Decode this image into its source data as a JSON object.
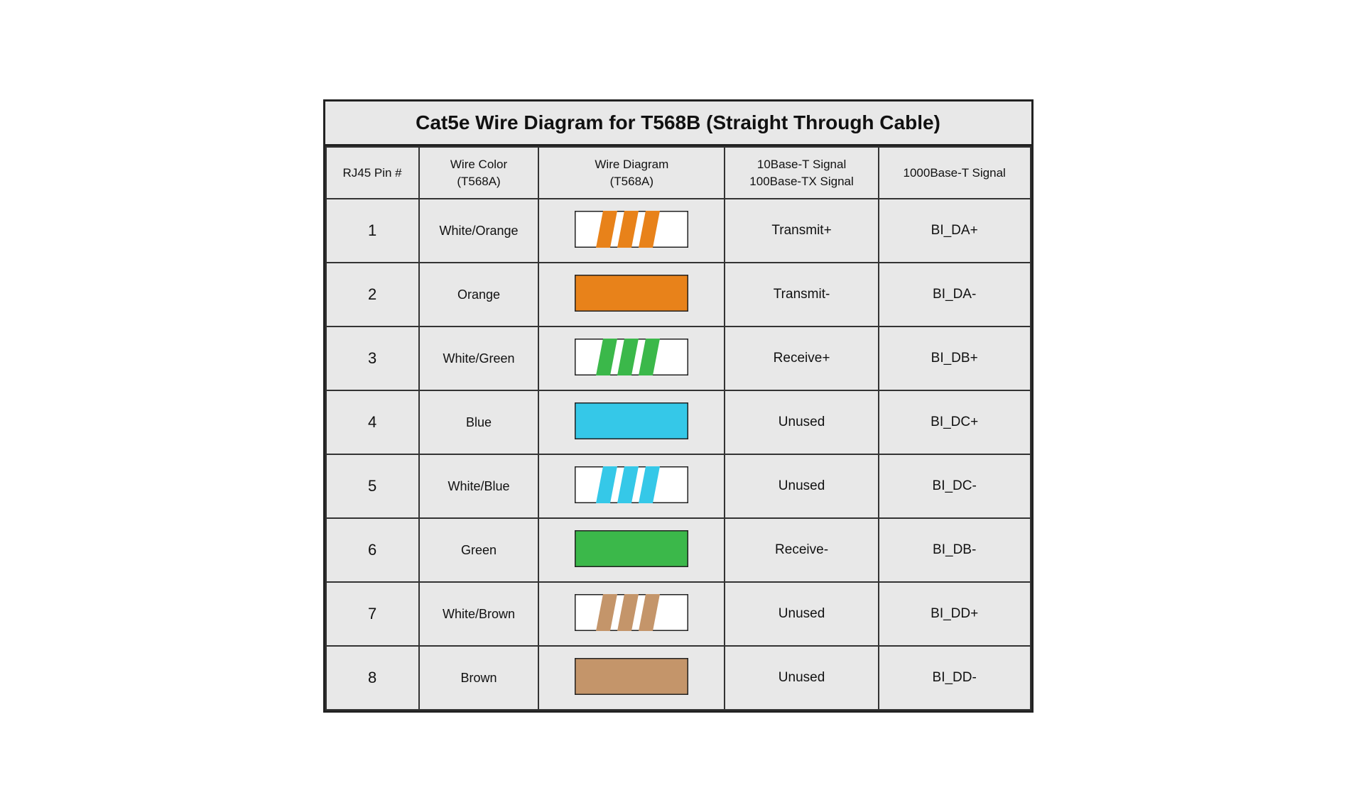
{
  "title": "Cat5e Wire Diagram for T568B (Straight Through Cable)",
  "headers": {
    "col1": "RJ45 Pin #",
    "col2": "Wire Color\n(T568A)",
    "col3": "Wire Diagram\n(T568A)",
    "col4": "10Base-T Signal\n100Base-TX Signal",
    "col5": "1000Base-T Signal"
  },
  "rows": [
    {
      "pin": "1",
      "color": "White/Orange",
      "diagram": "striped-orange",
      "signal_100": "Transmit+",
      "signal_1000": "BI_DA+"
    },
    {
      "pin": "2",
      "color": "Orange",
      "diagram": "solid-orange",
      "signal_100": "Transmit-",
      "signal_1000": "BI_DA-"
    },
    {
      "pin": "3",
      "color": "White/Green",
      "diagram": "striped-green",
      "signal_100": "Receive+",
      "signal_1000": "BI_DB+"
    },
    {
      "pin": "4",
      "color": "Blue",
      "diagram": "solid-blue",
      "signal_100": "Unused",
      "signal_1000": "BI_DC+"
    },
    {
      "pin": "5",
      "color": "White/Blue",
      "diagram": "striped-blue",
      "signal_100": "Unused",
      "signal_1000": "BI_DC-"
    },
    {
      "pin": "6",
      "color": "Green",
      "diagram": "solid-green",
      "signal_100": "Receive-",
      "signal_1000": "BI_DB-"
    },
    {
      "pin": "7",
      "color": "White/Brown",
      "diagram": "striped-brown",
      "signal_100": "Unused",
      "signal_1000": "BI_DD+"
    },
    {
      "pin": "8",
      "color": "Brown",
      "diagram": "solid-brown",
      "signal_100": "Unused",
      "signal_1000": "BI_DD-"
    }
  ],
  "colors": {
    "orange": "#E8821A",
    "green": "#3BB84A",
    "blue": "#35C8E8",
    "brown": "#C4956A",
    "white": "#FFFFFF",
    "border": "#222222",
    "bg": "#E8E8E8"
  }
}
